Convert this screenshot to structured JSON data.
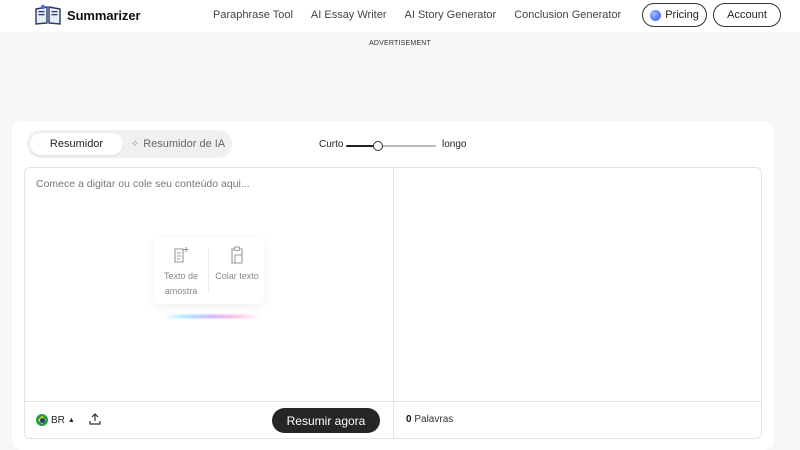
{
  "header": {
    "app_name": "Summarizer",
    "nav": [
      "Paraphrase Tool",
      "AI Essay Writer",
      "AI Story Generator",
      "Conclusion Generator"
    ],
    "pricing_label": "Pricing",
    "account_label": "Account"
  },
  "ad_label": "ADVERTISEMENT",
  "tabs": {
    "summarizer": "Resumidor",
    "ai_summarizer": "Resumidor de IA"
  },
  "length": {
    "short_label": "Curto",
    "long_label": "longo",
    "level": 0.35
  },
  "editor": {
    "placeholder": "Comece a digitar ou cole seu conteúdo aqui...",
    "sample_text_label": "Texto de amostra",
    "paste_text_label": "Colar texto"
  },
  "footer": {
    "language": "BR",
    "summarize_label": "Resumir agora",
    "word_count": "0",
    "words_label": "Palavras"
  },
  "colors": {
    "primary_button": "#262626",
    "accent": "#5b7bff"
  }
}
